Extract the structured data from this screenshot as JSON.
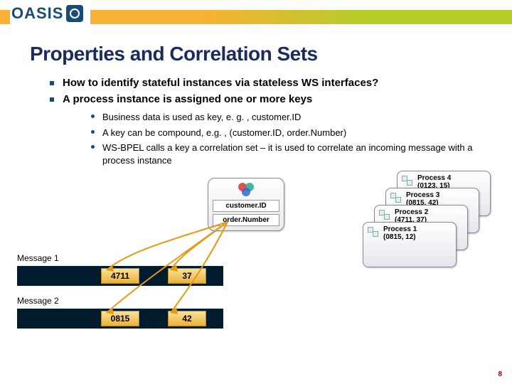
{
  "header": {
    "logo_text": "OASIS"
  },
  "title": "Properties and Correlation Sets",
  "bullets_lvl1": [
    "How to identify stateful instances via stateless WS interfaces?",
    "A process instance is assigned one or more keys"
  ],
  "bullets_lvl2": [
    "Business data is used as key, e. g. , customer.ID",
    "A key can be compound, e.g. , (customer.ID, order.Number)",
    "WS-BPEL calls a key a correlation set – it is used to correlate an incoming message with a process instance"
  ],
  "correlation_set": {
    "field1": "customer.ID",
    "field2": "order.Number"
  },
  "processes": {
    "p4": {
      "name": "Process 4",
      "key": "(0123, 15)"
    },
    "p3": {
      "name": "Process 3",
      "key": "(0815, 42)"
    },
    "p2": {
      "name": "Process 2",
      "key": "(4711, 37)"
    },
    "p1": {
      "name": "Process 1",
      "key": "(0815, 12)"
    }
  },
  "messages": {
    "m1": {
      "label": "Message 1",
      "v1": "4711",
      "v2": "37"
    },
    "m2": {
      "label": "Message 2",
      "v1": "0815",
      "v2": "42"
    }
  },
  "page_number": "8"
}
